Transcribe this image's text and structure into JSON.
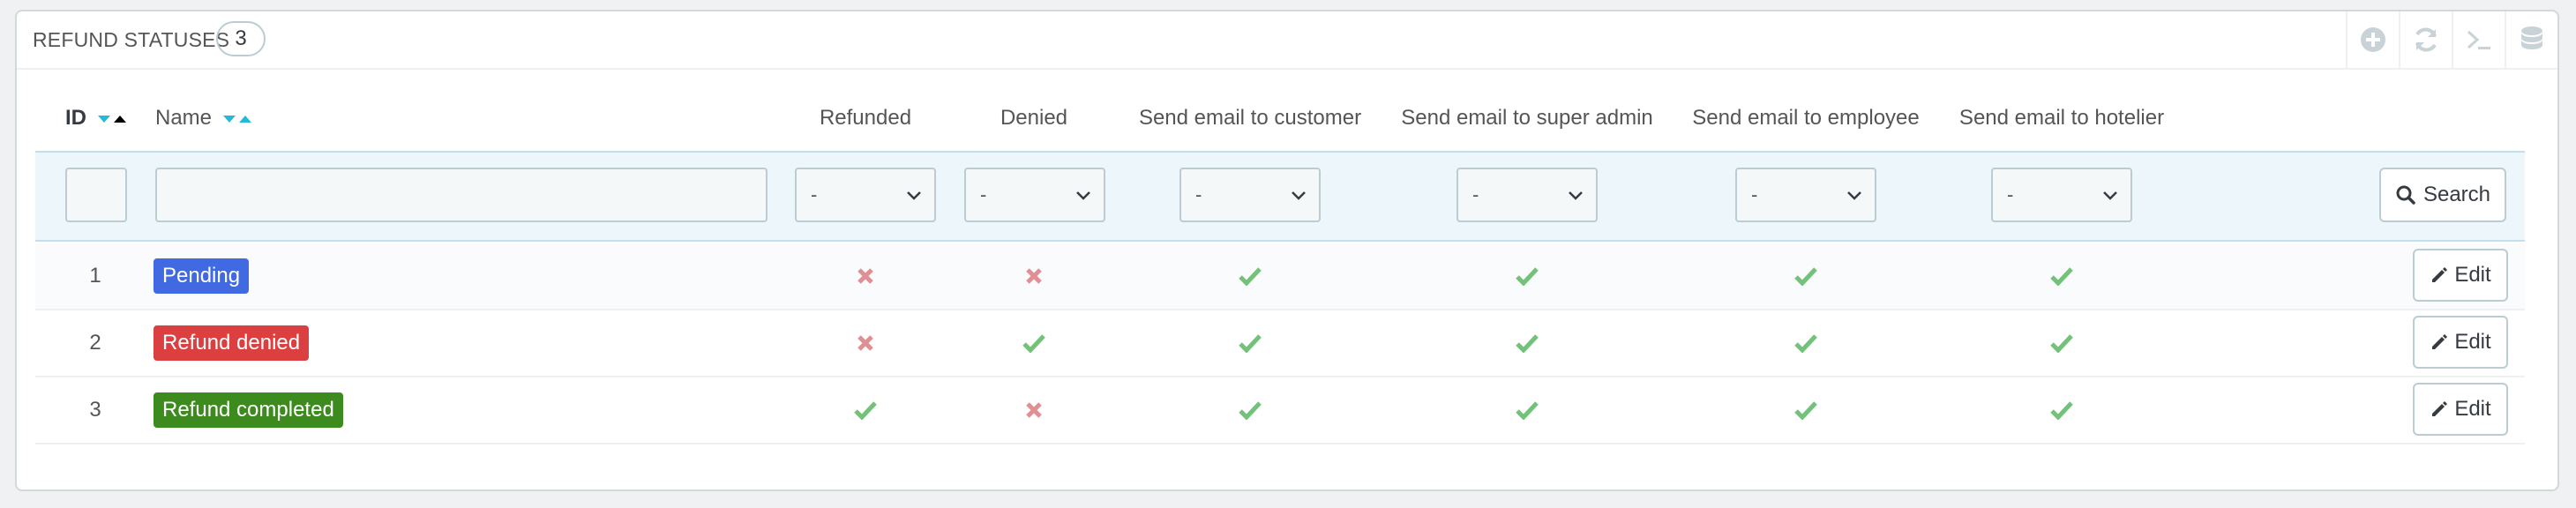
{
  "panel": {
    "title": "REFUND STATUSES",
    "count": "3",
    "toolbar": [
      {
        "icon": "add-circle-icon"
      },
      {
        "icon": "refresh-icon"
      },
      {
        "icon": "sql-terminal-icon"
      },
      {
        "icon": "database-icon"
      }
    ]
  },
  "table": {
    "columns": {
      "id": "ID",
      "name": "Name",
      "refunded": "Refunded",
      "denied": "Denied",
      "email_customer": "Send email to customer",
      "email_super_admin": "Send email to super admin",
      "email_employee": "Send email to employee",
      "email_hotelier": "Send email to hotelier"
    },
    "filters": {
      "id_value": "",
      "name_value": "",
      "select_default": "-",
      "search_label": "Search"
    },
    "rows": [
      {
        "id": "1",
        "name": "Pending",
        "color": "#4169e1",
        "refunded": false,
        "denied": false,
        "email_customer": true,
        "email_super_admin": true,
        "email_employee": true,
        "email_hotelier": true,
        "edit_label": "Edit"
      },
      {
        "id": "2",
        "name": "Refund denied",
        "color": "#dc143c",
        "refunded": false,
        "denied": true,
        "email_customer": true,
        "email_super_admin": true,
        "email_employee": true,
        "email_hotelier": true,
        "edit_label": "Edit"
      },
      {
        "id": "3",
        "name": "Refund completed",
        "color": "#32cd32",
        "refunded": true,
        "denied": false,
        "email_customer": true,
        "email_super_admin": true,
        "email_employee": true,
        "email_hotelier": true,
        "edit_label": "Edit"
      }
    ]
  },
  "colors": {
    "check": "#72c279",
    "cross": "#e08f95",
    "sort_active": "#25b9d7",
    "label_pending": "#4169e1",
    "label_denied": "#dc3f3f",
    "label_completed": "#3d8b1f"
  }
}
